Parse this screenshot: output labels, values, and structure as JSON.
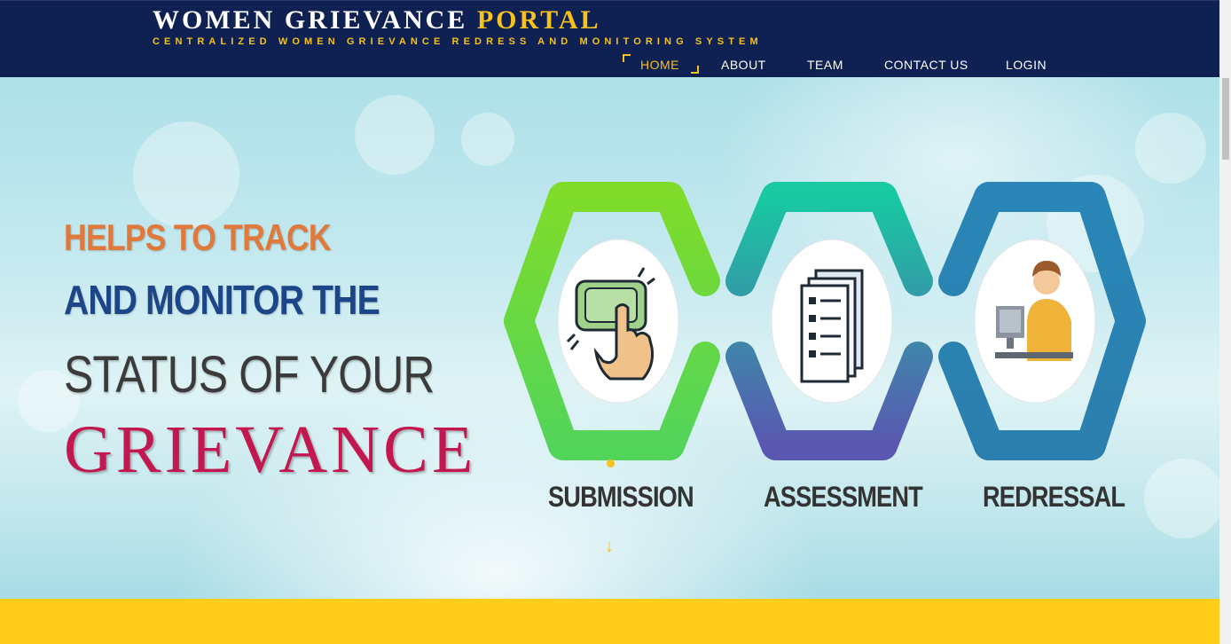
{
  "brand": {
    "title_main": "WOMEN GRIEVANCE ",
    "title_accent": "PORTAL",
    "subtitle": "CENTRALIZED WOMEN GRIEVANCE REDRESS AND MONITORING SYSTEM"
  },
  "nav": {
    "items": [
      {
        "label": "HOME",
        "active": true
      },
      {
        "label": "ABOUT"
      },
      {
        "label": "TEAM"
      },
      {
        "label": "CONTACT US"
      },
      {
        "label": "LOGIN"
      }
    ]
  },
  "hero": {
    "line1": "HELPS TO TRACK",
    "line2": "AND MONITOR THE",
    "line3": "STATUS OF YOUR",
    "line4": "GRIEVANCE",
    "steps": [
      {
        "label": "SUBMISSION",
        "icon": "pointer-click-icon"
      },
      {
        "label": "ASSESSMENT",
        "icon": "document-checklist-icon"
      },
      {
        "label": "REDRESSAL",
        "icon": "officer-at-desk-icon"
      }
    ],
    "scroll_glyph": "↓"
  },
  "colors": {
    "header_bg": "#0f2153",
    "accent_yellow": "#f6c21b",
    "band_yellow": "#ffcd1c",
    "line1": "#e07a3c",
    "line2": "#1d4688",
    "line4": "#c2174f"
  }
}
